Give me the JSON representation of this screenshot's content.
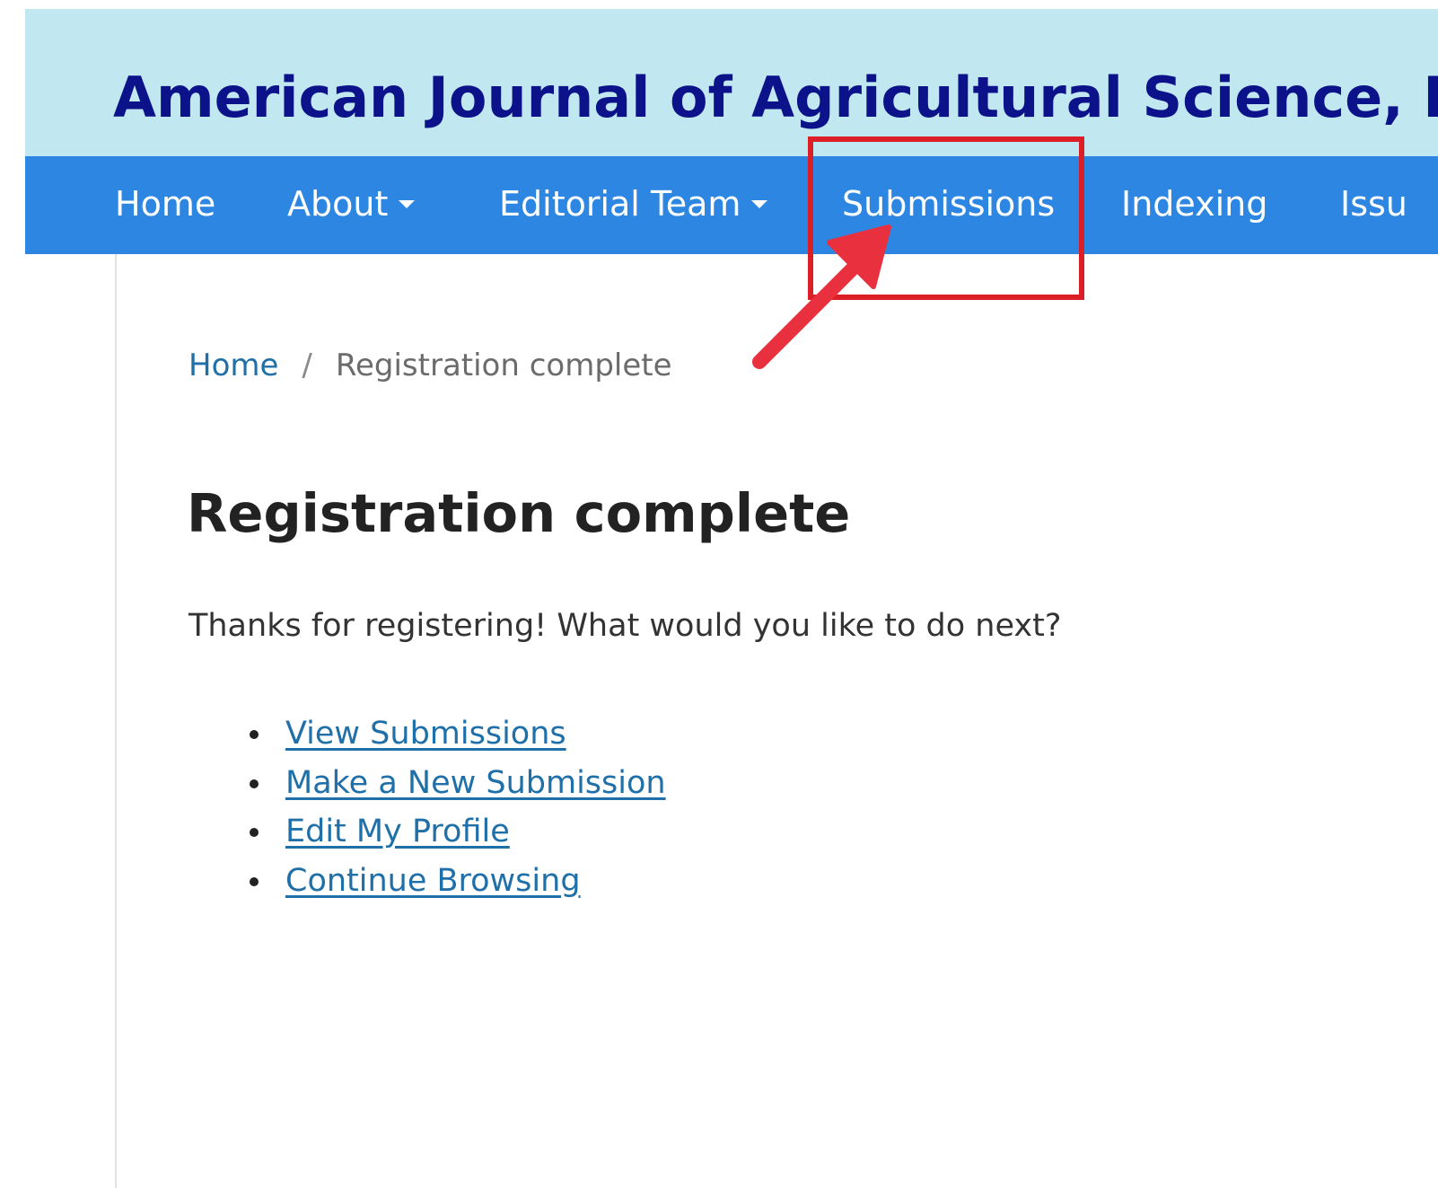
{
  "site": {
    "title": "American Journal of Agricultural Science, En"
  },
  "nav": {
    "items": [
      {
        "label": "Home",
        "has_dropdown": false
      },
      {
        "label": "About",
        "has_dropdown": true
      },
      {
        "label": "Editorial Team",
        "has_dropdown": true
      },
      {
        "label": "Submissions",
        "has_dropdown": false,
        "highlighted": true
      },
      {
        "label": "Indexing",
        "has_dropdown": false
      },
      {
        "label": "Issu",
        "has_dropdown": false
      }
    ]
  },
  "breadcrumb": {
    "home": "Home",
    "separator": "/",
    "current": "Registration complete"
  },
  "page": {
    "title": "Registration complete",
    "intro": "Thanks for registering! What would you like to do next?",
    "links": [
      "View Submissions",
      "Make a New Submission",
      "Edit My Profile",
      "Continue Browsing"
    ]
  },
  "annotation": {
    "highlight_target": "Submissions",
    "box_color": "#dc1f26",
    "arrow_color": "#e8303e",
    "arrow_icon": "pointer-arrow-icon"
  },
  "colors": {
    "header_bg": "#c1e7f0",
    "title": "#0c1289",
    "navbar_bg": "#2d87e2",
    "link": "#1f6fa8"
  }
}
